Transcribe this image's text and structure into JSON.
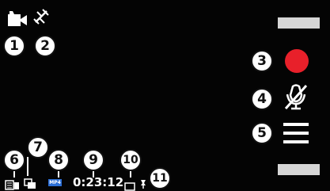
{
  "status_bar": {
    "camera_mode_icon": "video-camera-icon",
    "gps_icon": "gps-off-icon"
  },
  "controls": {
    "record_icon": "record-icon",
    "mute_icon": "microphone-muted-icon",
    "menu_icon": "menu-icon"
  },
  "bottom_bar": {
    "storage_icon": "memory-card-icon",
    "stabilization_icon": "stabilization-icon",
    "format_badge": "MP4",
    "recording_time": "0:23:12",
    "geotag_icon": "geotag-icon",
    "storage_location_icon": "storage-location-icon"
  },
  "callouts": [
    "1",
    "2",
    "3",
    "4",
    "5",
    "6",
    "7",
    "8",
    "9",
    "10",
    "11"
  ],
  "colors": {
    "background": "#040404",
    "record": "#e8202a",
    "icon": "#ffffff",
    "slot": "#d6d6d6",
    "format_badge": "#2c6fd6"
  }
}
